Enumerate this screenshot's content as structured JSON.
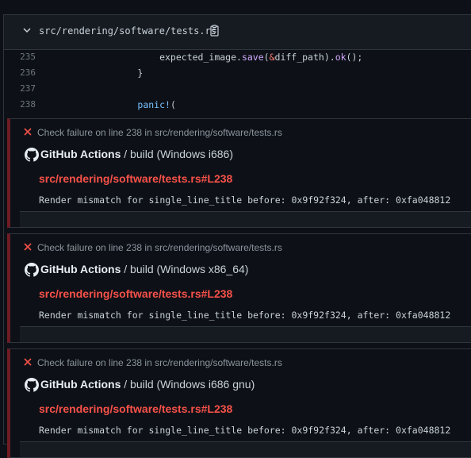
{
  "file": {
    "path": "src/rendering/software/tests.rs"
  },
  "code_lines": [
    {
      "num": "235",
      "parts": [
        [
          "",
          "            expected_image."
        ],
        [
          "method",
          "save"
        ],
        [
          "",
          "("
        ],
        [
          "op",
          "&"
        ],
        [
          "",
          "diff_path)."
        ],
        [
          "method",
          "ok"
        ],
        [
          "",
          "();"
        ]
      ]
    },
    {
      "num": "236",
      "parts": [
        [
          "",
          "        }"
        ]
      ]
    },
    {
      "num": "237",
      "parts": [
        [
          "",
          ""
        ]
      ]
    },
    {
      "num": "238",
      "parts": [
        [
          "",
          "        "
        ],
        [
          "macro",
          "panic!"
        ],
        [
          "",
          "("
        ]
      ]
    }
  ],
  "annotations": [
    {
      "title": "Check failure on line 238 in src/rendering/software/tests.rs",
      "app": "GitHub Actions",
      "separator": "/",
      "job": "build (Windows i686)",
      "link": "src/rendering/software/tests.rs#L238",
      "message": "Render mismatch for single_line_title before: 0x9f92f324, after: 0xfa048812"
    },
    {
      "title": "Check failure on line 238 in src/rendering/software/tests.rs",
      "app": "GitHub Actions",
      "separator": "/",
      "job": "build (Windows x86_64)",
      "link": "src/rendering/software/tests.rs#L238",
      "message": "Render mismatch for single_line_title before: 0x9f92f324, after: 0xfa048812"
    },
    {
      "title": "Check failure on line 238 in src/rendering/software/tests.rs",
      "app": "GitHub Actions",
      "separator": "/",
      "job": "build (Windows i686 gnu)",
      "link": "src/rendering/software/tests.rs#L238",
      "message": "Render mismatch for single_line_title before: 0x9f92f324, after: 0xfa048812"
    }
  ],
  "icons": {
    "collapse": "chevron-down-icon",
    "copy": "copy-icon",
    "failure": "x-icon",
    "app": "github-logo-icon"
  },
  "colors": {
    "failure": "#f85149",
    "failure_border": "#6e1b23",
    "background": "#0d1117"
  }
}
